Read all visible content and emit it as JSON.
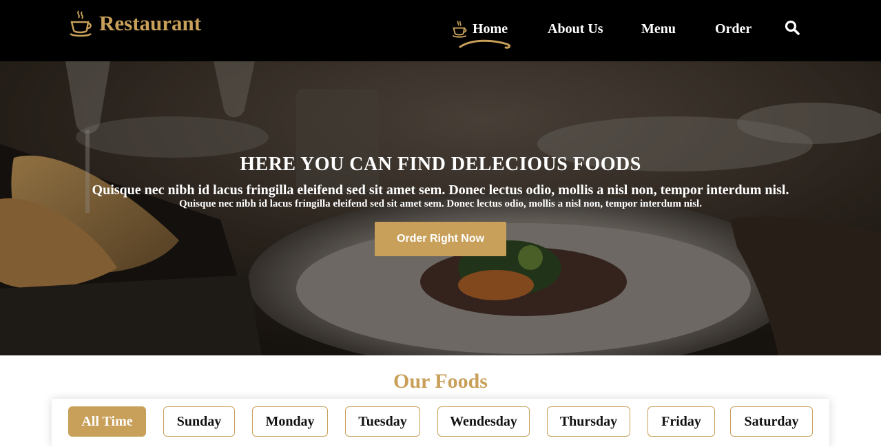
{
  "colors": {
    "accent": "#c8a05a",
    "nav_bg": "#000000",
    "text_light": "#ffffff"
  },
  "brand": {
    "name": "Restaurant",
    "icon": "coffee-cup-icon"
  },
  "nav": {
    "items": [
      {
        "label": "Home",
        "active": true,
        "icon": "coffee-cup-icon"
      },
      {
        "label": "About Us"
      },
      {
        "label": "Menu"
      },
      {
        "label": "Order"
      }
    ],
    "search_icon": "search-icon"
  },
  "hero": {
    "title": "HERE YOU CAN FIND DELECIOUS FOODS",
    "subtitle_large": "Quisque nec nibh id lacus fringilla eleifend sed sit amet sem. Donec lectus odio, mollis a nisl non, tempor interdum nisl.",
    "subtitle_small": "Quisque nec nibh id lacus fringilla eleifend sed sit amet sem. Donec lectus odio, mollis a nisl non, tempor interdum nisl.",
    "cta_label": "Order Right Now"
  },
  "foods": {
    "title": "Our Foods",
    "tabs": [
      {
        "label": "All Time",
        "active": true
      },
      {
        "label": "Sunday"
      },
      {
        "label": "Monday"
      },
      {
        "label": "Tuesday"
      },
      {
        "label": "Wendesday"
      },
      {
        "label": "Thursday"
      },
      {
        "label": "Friday"
      },
      {
        "label": "Saturday"
      }
    ]
  }
}
